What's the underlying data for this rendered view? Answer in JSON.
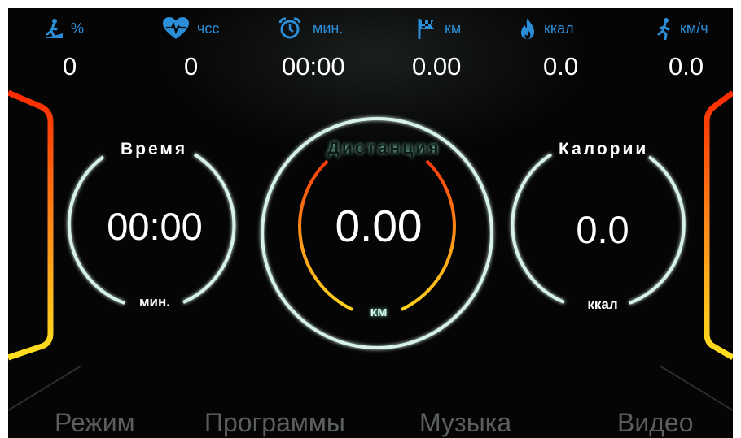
{
  "stats": [
    {
      "icon": "incline-icon",
      "unit": "%",
      "value": "0"
    },
    {
      "icon": "heart-rate-icon",
      "unit": "чсс",
      "value": "0"
    },
    {
      "icon": "alarm-clock-icon",
      "unit": "мин.",
      "value": "00:00"
    },
    {
      "icon": "finish-flag-icon",
      "unit": "км",
      "value": "0.00"
    },
    {
      "icon": "flame-icon",
      "unit": "ккал",
      "value": "0.0"
    },
    {
      "icon": "runner-icon",
      "unit": "км/ч",
      "value": "0.0"
    }
  ],
  "gauges": {
    "time": {
      "title": "Время",
      "value": "00:00",
      "unit": "мин."
    },
    "distance": {
      "title": "Дистанция",
      "value": "0.00",
      "unit": "км"
    },
    "calories": {
      "title": "Калории",
      "value": "0.0",
      "unit": "ккал"
    }
  },
  "nav": {
    "mode": "Режим",
    "programs": "Программы",
    "music": "Музыка",
    "video": "Видео"
  },
  "colors": {
    "accent_blue": "#2a8fd8",
    "ring": "#d7f2ea",
    "arc_hot": "#ff3a0a",
    "arc_warm": "#ffd21e"
  }
}
